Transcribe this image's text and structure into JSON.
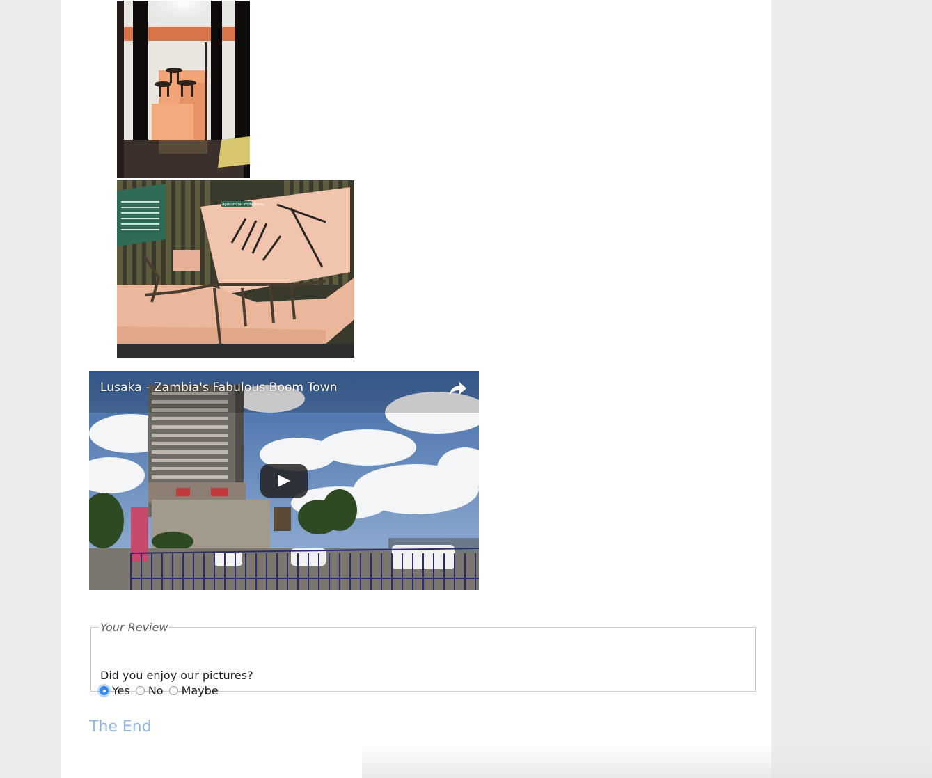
{
  "photos": [
    {
      "alt": "museum-display-case-stools"
    },
    {
      "alt": "agricultural-implements-display"
    }
  ],
  "photo2_sign": "Agricultural implements",
  "video": {
    "title": "Lusaka - Zambia's Fabulous Boom Town",
    "share_icon": "share-icon",
    "play_icon": "play-icon"
  },
  "review": {
    "legend": "Your Review",
    "question": "Did you enjoy our pictures?",
    "options": [
      {
        "label": "Yes",
        "checked": true
      },
      {
        "label": "No",
        "checked": false
      },
      {
        "label": "Maybe",
        "checked": false
      }
    ]
  },
  "footer": {
    "the_end": "The End"
  },
  "colors": {
    "page_bg": "#ececec",
    "content_bg": "#ffffff",
    "accent": "#8fb3d9",
    "radio_selected": "#3b8ef0"
  }
}
